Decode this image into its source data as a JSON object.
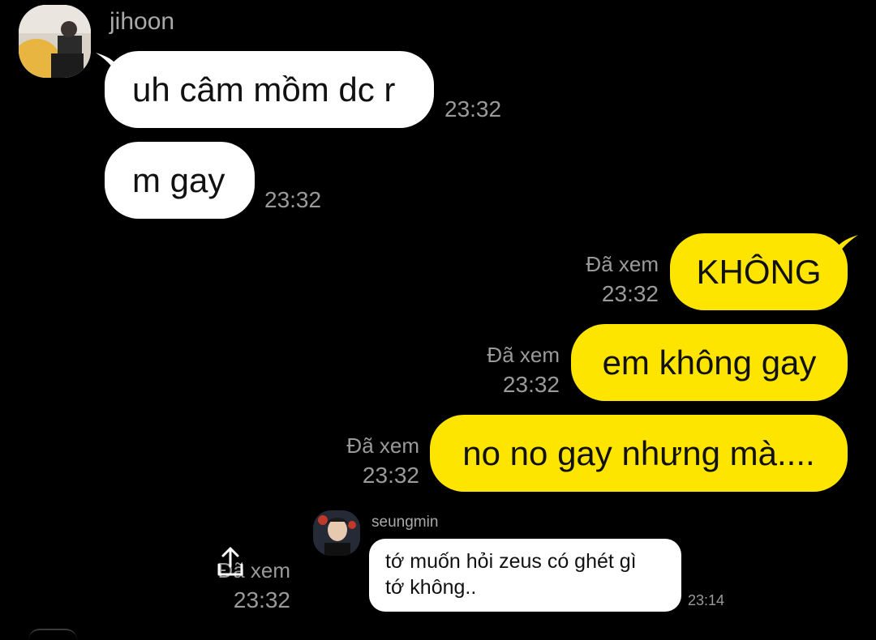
{
  "chat": {
    "sender": {
      "name": "jihoon",
      "avatar_icon": "profile-photo"
    },
    "incoming": [
      {
        "text": "uh câm mồm dc r",
        "time": "23:32"
      },
      {
        "text": "m gay",
        "time": "23:32"
      }
    ],
    "outgoing": [
      {
        "text": "KHÔNG",
        "status": "Đã xem",
        "time": "23:32"
      },
      {
        "text": "em không gay",
        "status": "Đã xem",
        "time": "23:32"
      },
      {
        "text": "no no gay nhưng mà....",
        "status": "Đã xem",
        "time": "23:32"
      }
    ],
    "shared_message": {
      "status": "Đã xem",
      "time": "23:32",
      "share_icon": "share-icon",
      "quoted": {
        "name": "seungmin",
        "line1": "tớ muốn hỏi zeus có ghét gì",
        "line2": "tớ không..",
        "time": "23:14"
      }
    }
  },
  "colors": {
    "background": "#000000",
    "incoming_bubble": "#ffffff",
    "outgoing_bubble": "#fee500",
    "meta_text": "#9a9a9a"
  }
}
